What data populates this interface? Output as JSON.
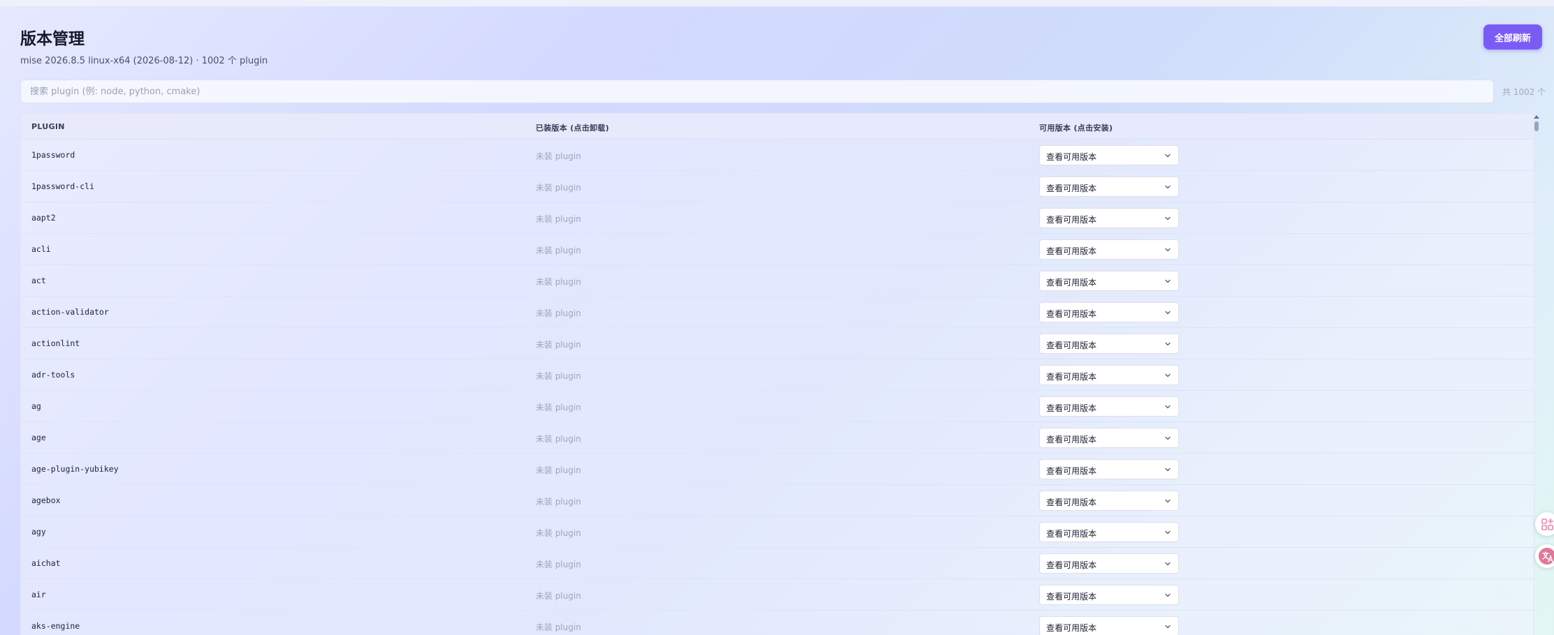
{
  "header": {
    "title": "版本管理",
    "subtitle": "mise 2026.8.5 linux-x64 (2026-08-12) · 1002 个 plugin",
    "refresh_label": "全部刷新"
  },
  "search": {
    "placeholder": "搜索 plugin (例: node, python, cmake)",
    "value": "",
    "count_label": "共 1002 个"
  },
  "table": {
    "columns": [
      "PLUGIN",
      "已装版本 (点击卸载)",
      "可用版本 (点击安装)"
    ],
    "rows": [
      {
        "plugin": "1password",
        "installed": "未装 plugin",
        "available": "查看可用版本"
      },
      {
        "plugin": "1password-cli",
        "installed": "未装 plugin",
        "available": "查看可用版本"
      },
      {
        "plugin": "aapt2",
        "installed": "未装 plugin",
        "available": "查看可用版本"
      },
      {
        "plugin": "acli",
        "installed": "未装 plugin",
        "available": "查看可用版本"
      },
      {
        "plugin": "act",
        "installed": "未装 plugin",
        "available": "查看可用版本"
      },
      {
        "plugin": "action-validator",
        "installed": "未装 plugin",
        "available": "查看可用版本"
      },
      {
        "plugin": "actionlint",
        "installed": "未装 plugin",
        "available": "查看可用版本"
      },
      {
        "plugin": "adr-tools",
        "installed": "未装 plugin",
        "available": "查看可用版本"
      },
      {
        "plugin": "ag",
        "installed": "未装 plugin",
        "available": "查看可用版本"
      },
      {
        "plugin": "age",
        "installed": "未装 plugin",
        "available": "查看可用版本"
      },
      {
        "plugin": "age-plugin-yubikey",
        "installed": "未装 plugin",
        "available": "查看可用版本"
      },
      {
        "plugin": "agebox",
        "installed": "未装 plugin",
        "available": "查看可用版本"
      },
      {
        "plugin": "agy",
        "installed": "未装 plugin",
        "available": "查看可用版本"
      },
      {
        "plugin": "aichat",
        "installed": "未装 plugin",
        "available": "查看可用版本"
      },
      {
        "plugin": "air",
        "installed": "未装 plugin",
        "available": "查看可用版本"
      },
      {
        "plugin": "aks-engine",
        "installed": "未装 plugin",
        "available": "查看可用版本"
      }
    ]
  },
  "icons": {
    "select_chevron": "chevron-down-icon",
    "float_top": "apps-grid-icon",
    "float_bottom": "translate-icon"
  },
  "colors": {
    "accent": "#7a5cf5",
    "translate_icon": "#e0789a",
    "apps_icon": "#e58aa8"
  }
}
